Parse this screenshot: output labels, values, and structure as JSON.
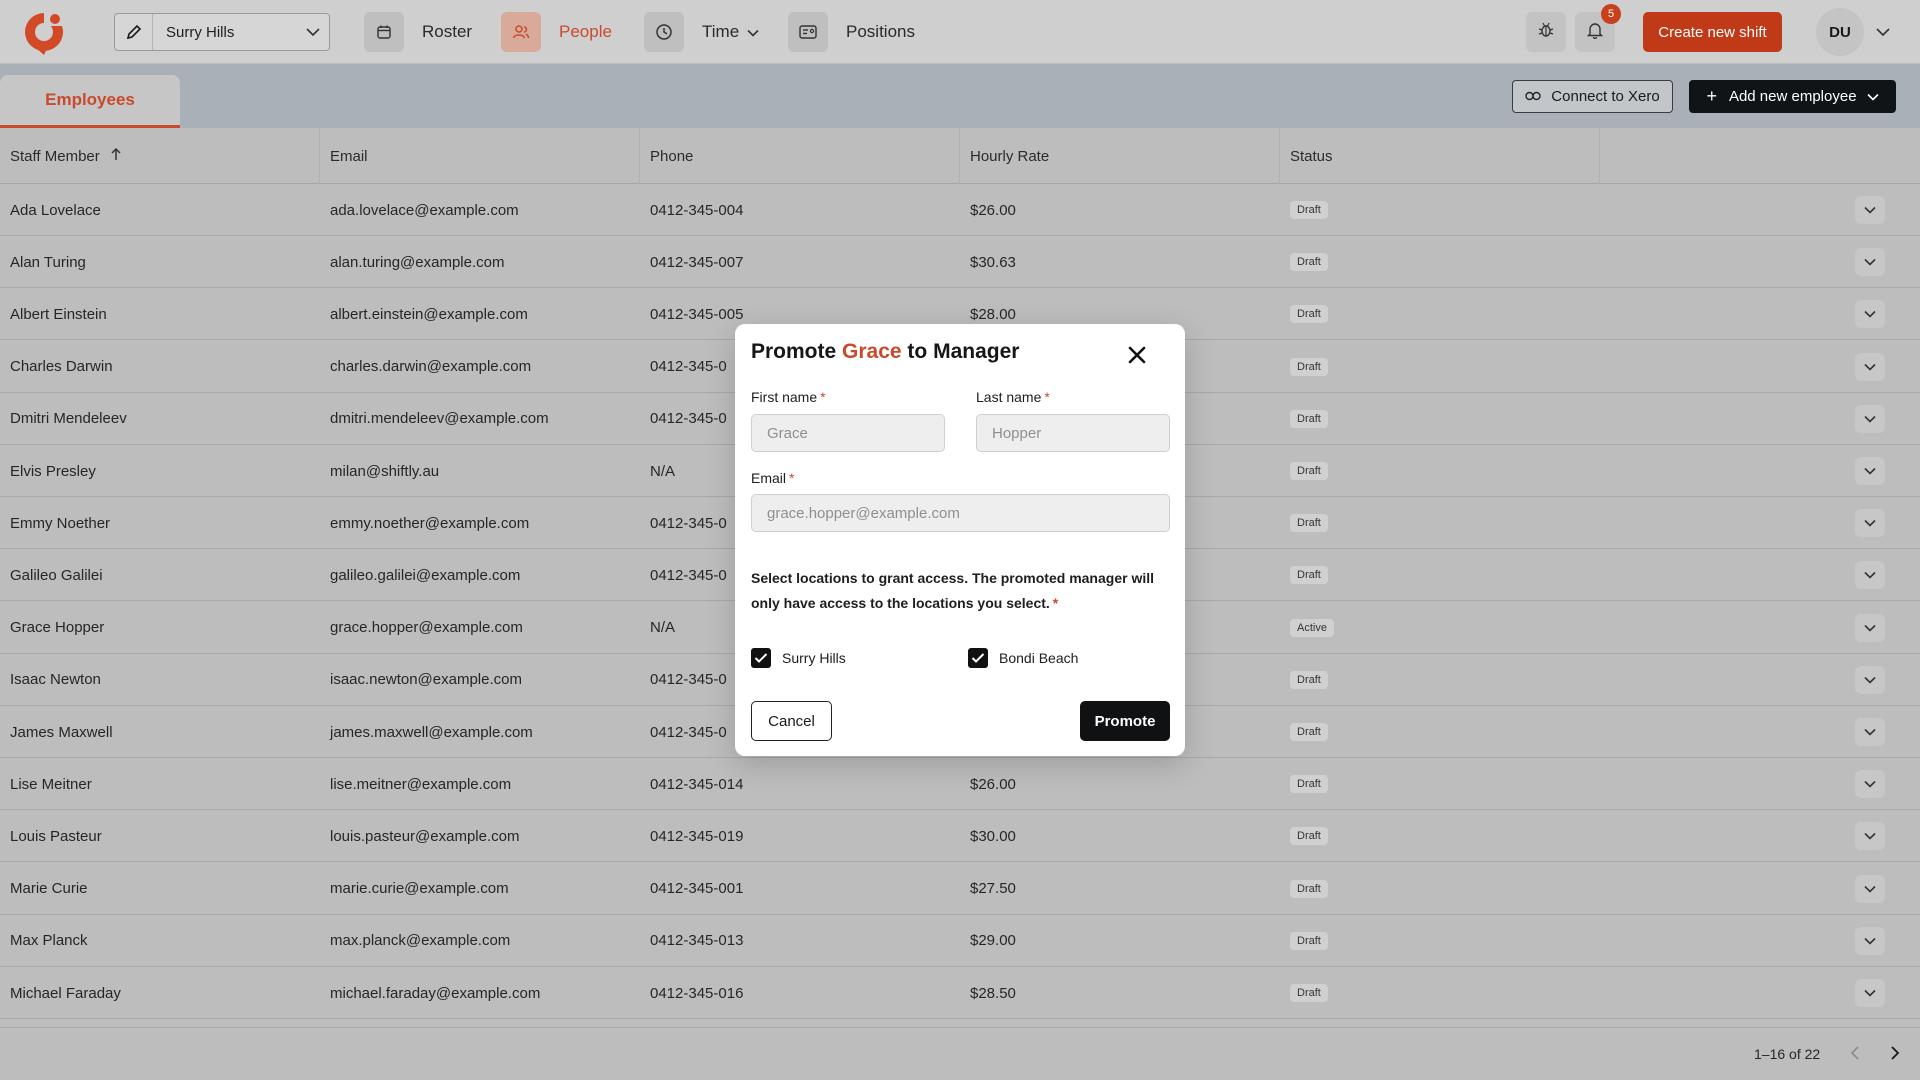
{
  "nav": {
    "location": "Surry Hills",
    "items": [
      {
        "id": "roster",
        "label": "Roster",
        "icon": "calendar-icon"
      },
      {
        "id": "people",
        "label": "People",
        "icon": "people-icon",
        "active": true
      },
      {
        "id": "time",
        "label": "Time",
        "icon": "clock-icon",
        "has_dropdown": true
      },
      {
        "id": "positions",
        "label": "Positions",
        "icon": "id-card-icon"
      }
    ],
    "notification_count": "5",
    "create_shift_label": "Create new shift",
    "avatar_initials": "DU"
  },
  "tabs": {
    "employees": "Employees"
  },
  "actions": {
    "connect_xero": "Connect to Xero",
    "add_employee": "Add new employee"
  },
  "table": {
    "columns": [
      "Staff Member",
      "Email",
      "Phone",
      "Hourly Rate",
      "Status"
    ],
    "rows": [
      {
        "name": "Ada Lovelace",
        "email": "ada.lovelace@example.com",
        "phone": "0412-345-004",
        "rate": "$26.00",
        "status": "Draft"
      },
      {
        "name": "Alan Turing",
        "email": "alan.turing@example.com",
        "phone": "0412-345-007",
        "rate": "$30.63",
        "status": "Draft"
      },
      {
        "name": "Albert Einstein",
        "email": "albert.einstein@example.com",
        "phone": "0412-345-005",
        "rate": "$28.00",
        "status": "Draft"
      },
      {
        "name": "Charles Darwin",
        "email": "charles.darwin@example.com",
        "phone": "0412-345-0",
        "rate": "",
        "status": "Draft"
      },
      {
        "name": "Dmitri Mendeleev",
        "email": "dmitri.mendeleev@example.com",
        "phone": "0412-345-0",
        "rate": "",
        "status": "Draft"
      },
      {
        "name": "Elvis Presley",
        "email": "milan@shiftly.au",
        "phone": "N/A",
        "rate": "",
        "status": "Draft"
      },
      {
        "name": "Emmy Noether",
        "email": "emmy.noether@example.com",
        "phone": "0412-345-0",
        "rate": "",
        "status": "Draft"
      },
      {
        "name": "Galileo Galilei",
        "email": "galileo.galilei@example.com",
        "phone": "0412-345-0",
        "rate": "",
        "status": "Draft"
      },
      {
        "name": "Grace Hopper",
        "email": "grace.hopper@example.com",
        "phone": "N/A",
        "rate": "",
        "status": "Active"
      },
      {
        "name": "Isaac Newton",
        "email": "isaac.newton@example.com",
        "phone": "0412-345-0",
        "rate": "",
        "status": "Draft"
      },
      {
        "name": "James Maxwell",
        "email": "james.maxwell@example.com",
        "phone": "0412-345-0",
        "rate": "",
        "status": "Draft"
      },
      {
        "name": "Lise Meitner",
        "email": "lise.meitner@example.com",
        "phone": "0412-345-014",
        "rate": "$26.00",
        "status": "Draft"
      },
      {
        "name": "Louis Pasteur",
        "email": "louis.pasteur@example.com",
        "phone": "0412-345-019",
        "rate": "$30.00",
        "status": "Draft"
      },
      {
        "name": "Marie Curie",
        "email": "marie.curie@example.com",
        "phone": "0412-345-001",
        "rate": "$27.50",
        "status": "Draft"
      },
      {
        "name": "Max Planck",
        "email": "max.planck@example.com",
        "phone": "0412-345-013",
        "rate": "$29.00",
        "status": "Draft"
      },
      {
        "name": "Michael Faraday",
        "email": "michael.faraday@example.com",
        "phone": "0412-345-016",
        "rate": "$28.50",
        "status": "Draft"
      }
    ]
  },
  "pagination": {
    "range": "1–16 of 22"
  },
  "modal": {
    "title_prefix": "Promote",
    "title_name": "Grace",
    "title_suffix": "to Manager",
    "first_name_label": "First name",
    "first_name_value": "Grace",
    "last_name_label": "Last name",
    "last_name_value": "Hopper",
    "email_label": "Email",
    "email_value": "grace.hopper@example.com",
    "required_mark": "*",
    "locations_desc": "Select locations to grant access. The promoted manager will only have access to the locations you select.",
    "locations": [
      {
        "label": "Surry Hills",
        "checked": true
      },
      {
        "label": "Bondi Beach",
        "checked": true
      }
    ],
    "cancel_label": "Cancel",
    "promote_label": "Promote"
  },
  "colors": {
    "accent": "#c94a2c",
    "primary_dark": "#0f1113",
    "create_button": "#c13a17"
  }
}
